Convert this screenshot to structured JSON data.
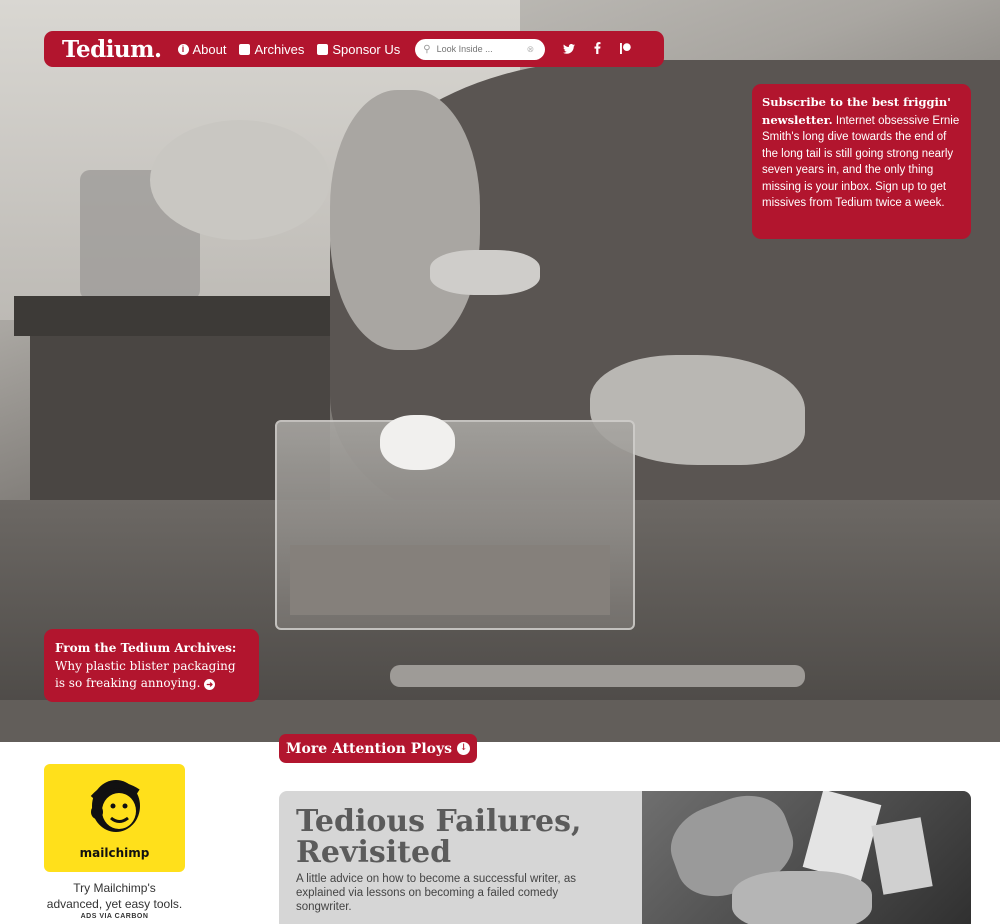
{
  "nav": {
    "logo": "Tedium.",
    "items": [
      {
        "label": "About",
        "icon": "info-icon"
      },
      {
        "label": "Archives",
        "icon": "archive-box-icon"
      },
      {
        "label": "Sponsor Us",
        "icon": "document-icon"
      }
    ],
    "search_placeholder": "Look Inside ...",
    "social": [
      "twitter-icon",
      "facebook-icon",
      "patreon-icon"
    ]
  },
  "subscribe": {
    "bold": "Subscribe to the best friggin' newsletter.",
    "text": " Internet obsessive Ernie Smith's long dive towards the end of the long tail is still going strong nearly seven years in, and the only thing missing is your inbox. Sign up to get missives from Tedium twice a week."
  },
  "archives": {
    "heading": "From the Tedium Archives:",
    "link": "Why plastic blister packaging is so freaking annoying."
  },
  "more_button": "More Attention Ploys",
  "ad": {
    "wordmark": "mailchimp",
    "text": "Try Mailchimp's advanced, yet easy tools.",
    "via": "ADS VIA CARBON"
  },
  "feature": {
    "title": "Tedious Failures, Revisited",
    "description": "A little advice on how to become a successful writer, as explained via lessons on becoming a failed comedy songwriter."
  },
  "colors": {
    "brand_red": "#b2152e",
    "ad_yellow": "#ffe01b",
    "card_gray": "#d6d6d6"
  }
}
